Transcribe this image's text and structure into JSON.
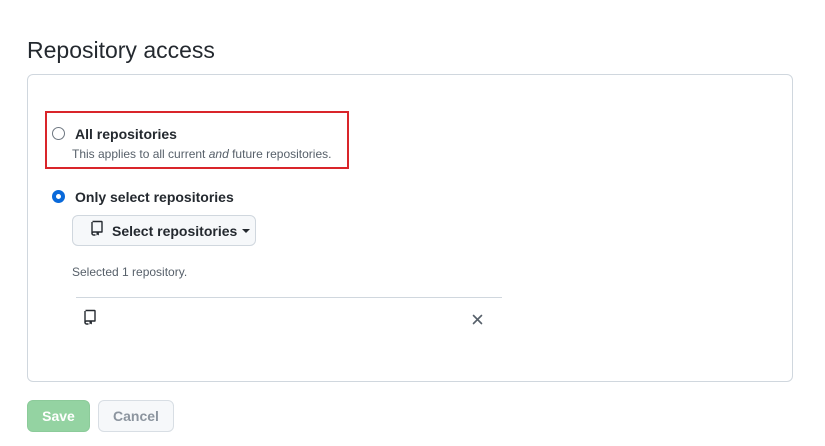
{
  "section": {
    "title": "Repository access"
  },
  "options": {
    "all": {
      "label": "All repositories",
      "note_prefix": "This applies to all current ",
      "note_emphasis": "and",
      "note_suffix": " future repositories.",
      "checked": false
    },
    "select": {
      "label": "Only select repositories",
      "checked": true
    }
  },
  "select_button": {
    "label": "Select repositories",
    "icon": "repo-icon"
  },
  "selected_count": "Selected 1 repository.",
  "selected_repos": [
    {
      "name": "",
      "icon": "repo-icon"
    }
  ],
  "actions": {
    "save_label": "Save",
    "cancel_label": "Cancel"
  },
  "colors": {
    "accent": "#0969da",
    "highlight": "#d9252a",
    "save_disabled": "#94d3a2"
  }
}
